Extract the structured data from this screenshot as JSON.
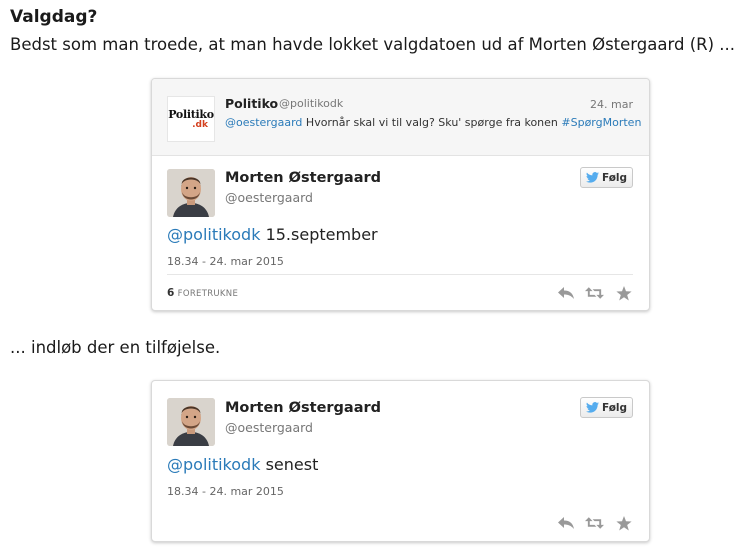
{
  "heading": "Valgdag?",
  "intro": "Bedst som man troede, at man havde lokket valgdatoen ud af Morten Østergaard (R) ...",
  "transition": "... indløb der en tilføjelse.",
  "tweet1": {
    "quoted": {
      "logo_text_1": "Politiko",
      "logo_text_2": ".dk",
      "name": "Politiko",
      "handle": "@politikodk",
      "date": "24. mar",
      "mention": "@oestergaard",
      "text": "Hvornår skal vi til valg? Sku' spørge fra konen",
      "hashtag": "#SpørgMorten"
    },
    "name": "Morten Østergaard",
    "handle": "@oestergaard",
    "follow_label": "Følg",
    "mention": "@politikodk",
    "text": "15.september",
    "timestamp": "18.34 - 24. mar 2015",
    "fav_count": "6",
    "fav_label": "FORETRUKNE"
  },
  "tweet2": {
    "name": "Morten Østergaard",
    "handle": "@oestergaard",
    "follow_label": "Følg",
    "mention": "@politikodk",
    "text": "senest",
    "timestamp": "18.34 - 24. mar 2015"
  },
  "colors": {
    "link": "#2b7bb9",
    "twitter_bird": "#55acee",
    "politiko_red": "#d4401f"
  },
  "icons": [
    "twitter-bird-icon",
    "reply-icon",
    "retweet-icon",
    "favorite-icon"
  ]
}
